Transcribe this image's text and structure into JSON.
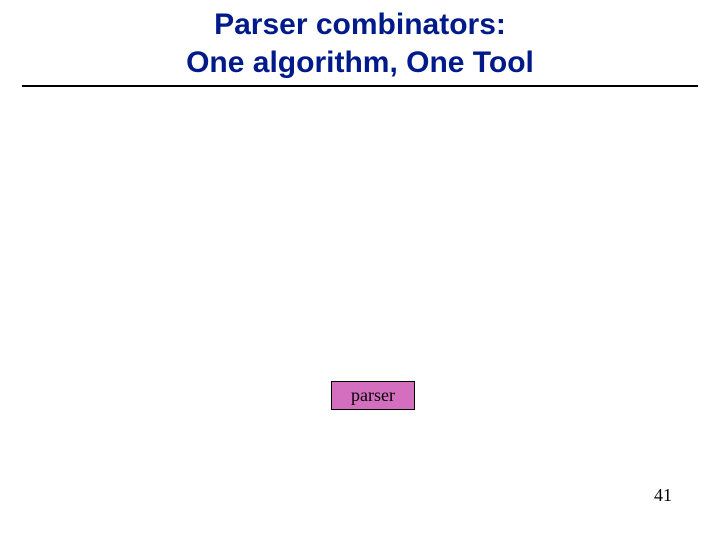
{
  "title": {
    "line1": "Parser combinators:",
    "line2": "One algorithm, One Tool"
  },
  "box": {
    "label": "parser"
  },
  "page_number": "41"
}
